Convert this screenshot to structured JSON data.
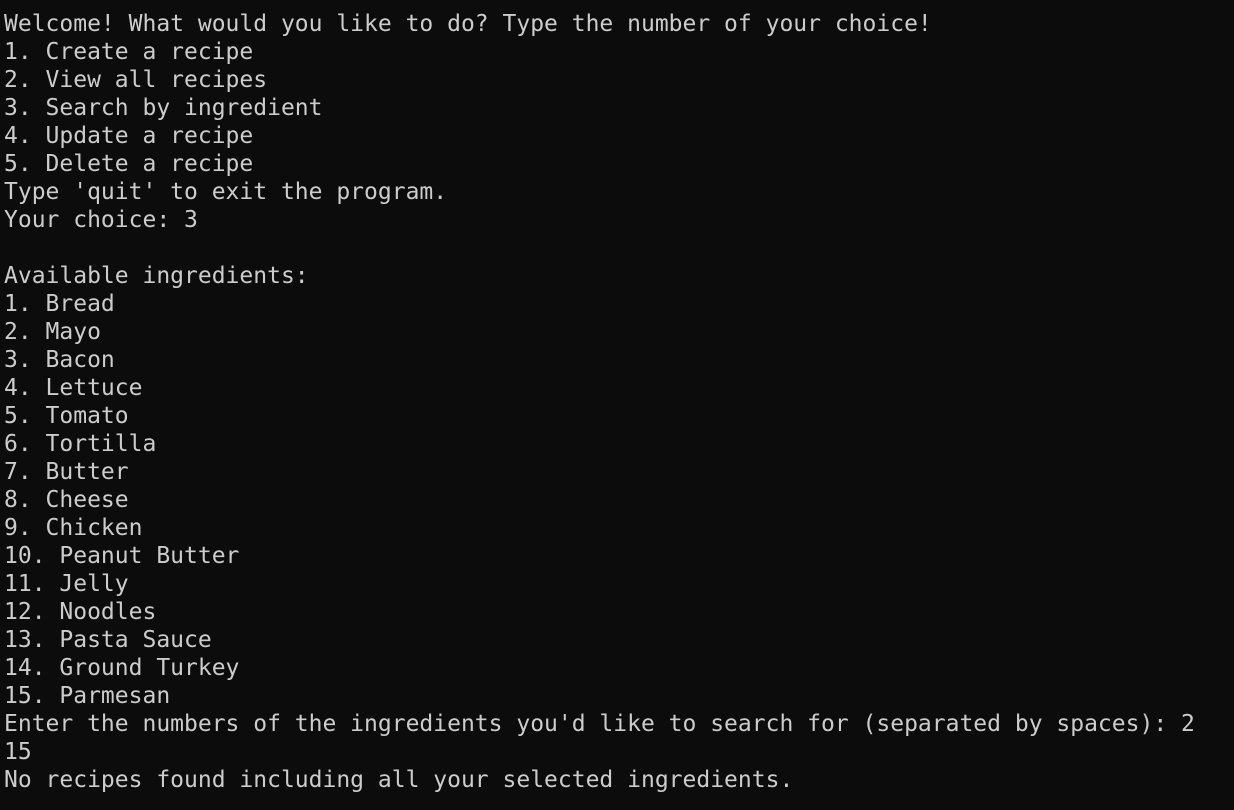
{
  "terminal": {
    "welcome": "Welcome! What would you like to do? Type the number of your choice!",
    "menu": [
      "1. Create a recipe",
      "2. View all recipes",
      "3. Search by ingredient",
      "4. Update a recipe",
      "5. Delete a recipe"
    ],
    "quit_hint": "Type 'quit' to exit the program.",
    "choice_prompt": "Your choice: 3",
    "available_header": "Available ingredients:",
    "ingredients": [
      "1. Bread",
      "2. Mayo",
      "3. Bacon",
      "4. Lettuce",
      "5. Tomato",
      "6. Tortilla",
      "7. Butter",
      "8. Cheese",
      "9. Chicken",
      "10. Peanut Butter",
      "11. Jelly",
      "12. Noodles",
      "13. Pasta Sauce",
      "14. Ground Turkey",
      "15. Parmesan"
    ],
    "search_prompt": "Enter the numbers of the ingredients you'd like to search for (separated by spaces): 2",
    "search_input_wrap": "15",
    "result": "No recipes found including all your selected ingredients."
  },
  "colors": {
    "background": "#0c0c0c",
    "text": "#cccccc"
  }
}
